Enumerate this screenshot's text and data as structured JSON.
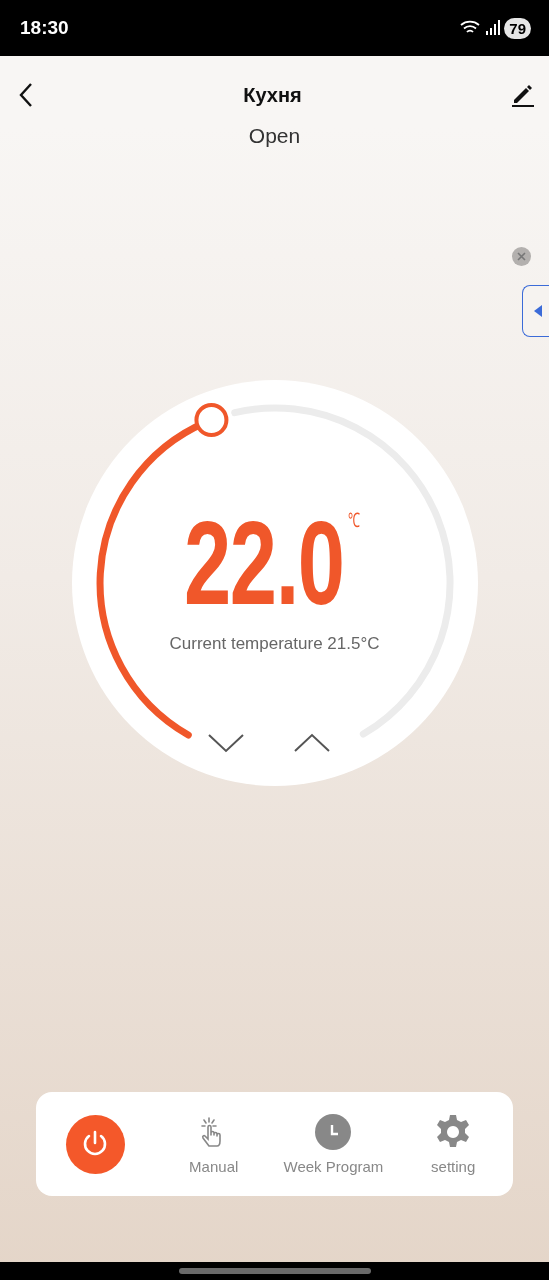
{
  "status_bar": {
    "time": "18:30",
    "battery": "79"
  },
  "header": {
    "title": "Кухня"
  },
  "status": "Open",
  "thermostat": {
    "setpoint": "22.0",
    "unit": "℃",
    "current": "Current temperature 21.5°C"
  },
  "bottom_bar": {
    "power": {
      "on": true
    },
    "items": [
      {
        "kind": "manual",
        "label": "Manual"
      },
      {
        "kind": "week",
        "label": "Week Program"
      },
      {
        "kind": "setting",
        "label": "setting"
      }
    ]
  }
}
